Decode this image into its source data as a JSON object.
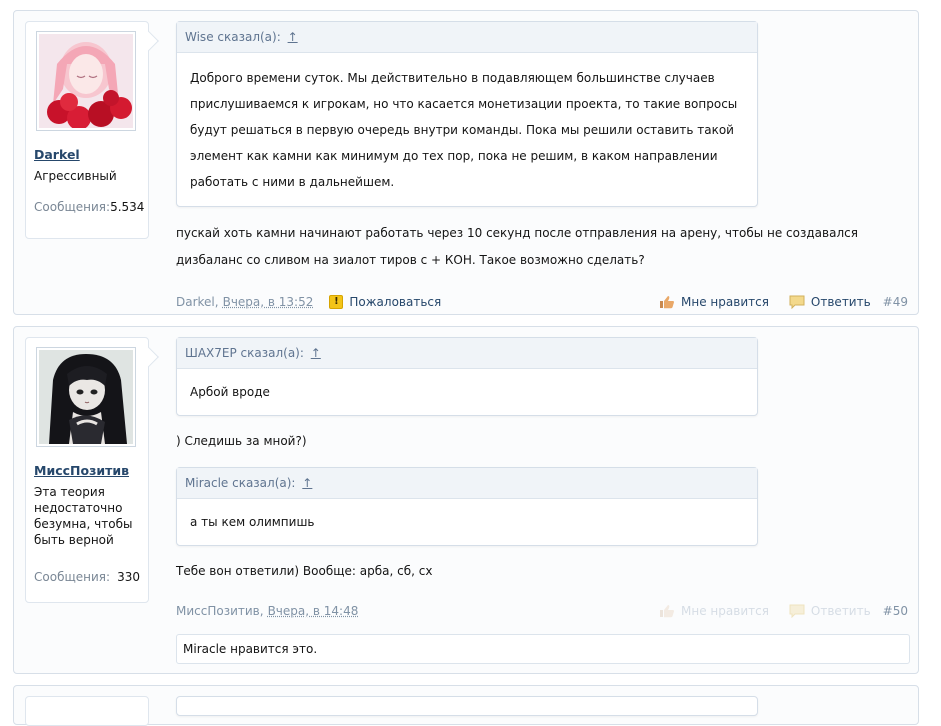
{
  "posts": [
    {
      "user": {
        "name": "Darkel",
        "title": "Агрессивный",
        "stats_label": "Сообщения:",
        "stats_value": "5.534"
      },
      "quote": {
        "header": "Wise сказал(а):",
        "up_icon": "↑",
        "text": "Доброго времени суток. Мы действительно в подавляющем большинстве случаев прислушиваемся к игрокам, но что касается монетизации проекта, то такие вопросы будут решаться в первую очередь внутри команды. Пока мы решили оставить такой элемент как камни как минимум до тех пор, пока не решим, в каком направлении работать с ними в дальнейшем."
      },
      "message": "пускай хоть камни начинают работать через 10 секунд после отправления на арену, чтобы не создавался дизбаланс со сливом на зиалот тиров с + КОН. Такое возможно сделать?",
      "meta": {
        "author": "Darkel,",
        "date": "Вчера, в 13:52",
        "report_label": "Пожаловаться",
        "like_label": "Мне нравится",
        "reply_label": "Ответить",
        "number": "#49"
      }
    },
    {
      "user": {
        "name": "МиссПозитив",
        "title": "Эта теория недостаточно безумна, чтобы быть верной",
        "stats_label": "Сообщения:",
        "stats_value": "330"
      },
      "quote1": {
        "header": "ШАХ7ЕР сказал(а):",
        "up_icon": "↑",
        "text": "Арбой вроде"
      },
      "message1": ") Следишь за мной?)",
      "quote2": {
        "header": "Miracle сказал(а):",
        "up_icon": "↑",
        "text": "а ты кем олимпишь"
      },
      "message2": "Тебе вон ответили) Вообще: арба, сб, сх",
      "meta": {
        "author": "МиссПозитив,",
        "date": "Вчера, в 14:48",
        "like_label": "Мне нравится",
        "reply_label": "Ответить",
        "number": "#50"
      },
      "likes": "Miracle нравится это."
    }
  ],
  "colors": {
    "link": "#26476b",
    "muted": "#8092a5",
    "border": "#d7dfe8"
  }
}
